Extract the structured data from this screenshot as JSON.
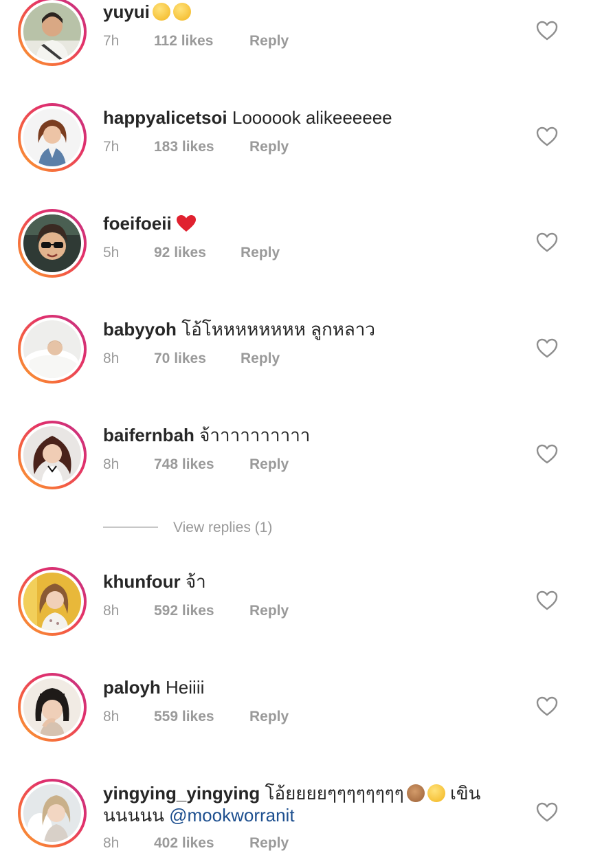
{
  "comments": [
    {
      "username": "yuyui",
      "text": "",
      "emoji": [
        "pleading-face",
        "pleading-face"
      ],
      "time": "7h",
      "likes": "112 likes",
      "reply": "Reply",
      "avatar": "woman-in-car-photo"
    },
    {
      "username": "happyalicetsoi",
      "text": "Loooook alikeeeeee",
      "time": "7h",
      "likes": "183 likes",
      "reply": "Reply",
      "avatar": "woman-brown-hair-photo"
    },
    {
      "username": "foeifoeii",
      "text": "",
      "emoji": [
        "red-heart"
      ],
      "time": "5h",
      "likes": "92 likes",
      "reply": "Reply",
      "avatar": "man-sunglasses-photo"
    },
    {
      "username": "babyyoh",
      "text": "โอ้โหหหหหหหห ลูกหลาว",
      "time": "8h",
      "likes": "70 likes",
      "reply": "Reply",
      "avatar": "baby-in-bed-photo"
    },
    {
      "username": "baifernbah",
      "text": "จ้าาาาาาาาาา",
      "time": "8h",
      "likes": "748 likes",
      "reply": "Reply",
      "avatar": "woman-curly-hair-photo"
    },
    {
      "username": "khunfour",
      "text": "จ้า",
      "time": "8h",
      "likes": "592 likes",
      "reply": "Reply",
      "avatar": "woman-yellow-background-photo"
    },
    {
      "username": "paloyh",
      "text": "Heiiii",
      "time": "8h",
      "likes": "559 likes",
      "reply": "Reply",
      "avatar": "woman-bangs-photo"
    },
    {
      "username": "yingying_yingying",
      "text": "โอ้ยยยยๆๆๆๆๆๆๆๆ",
      "emoji": [
        "see-no-evil-monkey",
        "smiling-face-with-heart-eyes"
      ],
      "text_after": "เขิน",
      "text_line2": "นนนนน",
      "mention": "@mookworranit",
      "time": "8h",
      "likes": "402 likes",
      "reply": "Reply",
      "avatar": "woman-light-hair-photo"
    }
  ],
  "view_replies": "View replies (1)",
  "icons": {
    "like": "heart-outline-icon"
  },
  "colors": {
    "ring_gradient": [
      "#f9a531",
      "#f56040",
      "#e1306c",
      "#c13584"
    ],
    "meta_gray": "#9a9a9a",
    "mention_blue": "#1d4f8f"
  }
}
